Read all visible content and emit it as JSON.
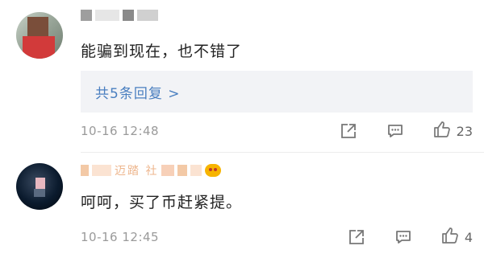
{
  "comments": [
    {
      "text": "能骗到现在，也不错了",
      "replies_label": "共5条回复 >",
      "timestamp": "10-16 12:48",
      "like_count": "23"
    },
    {
      "username_partial": "迈踏 社",
      "text": "呵呵，买了币赶紧提。",
      "timestamp": "10-16 12:45",
      "like_count": "4"
    }
  ],
  "icons": {
    "share": "share-icon",
    "comment": "comment-icon",
    "like": "thumbs-up-icon"
  },
  "colors": {
    "link": "#4a7fc0",
    "meta_text": "#9a9a9a",
    "reply_bg": "#f2f3f6"
  }
}
